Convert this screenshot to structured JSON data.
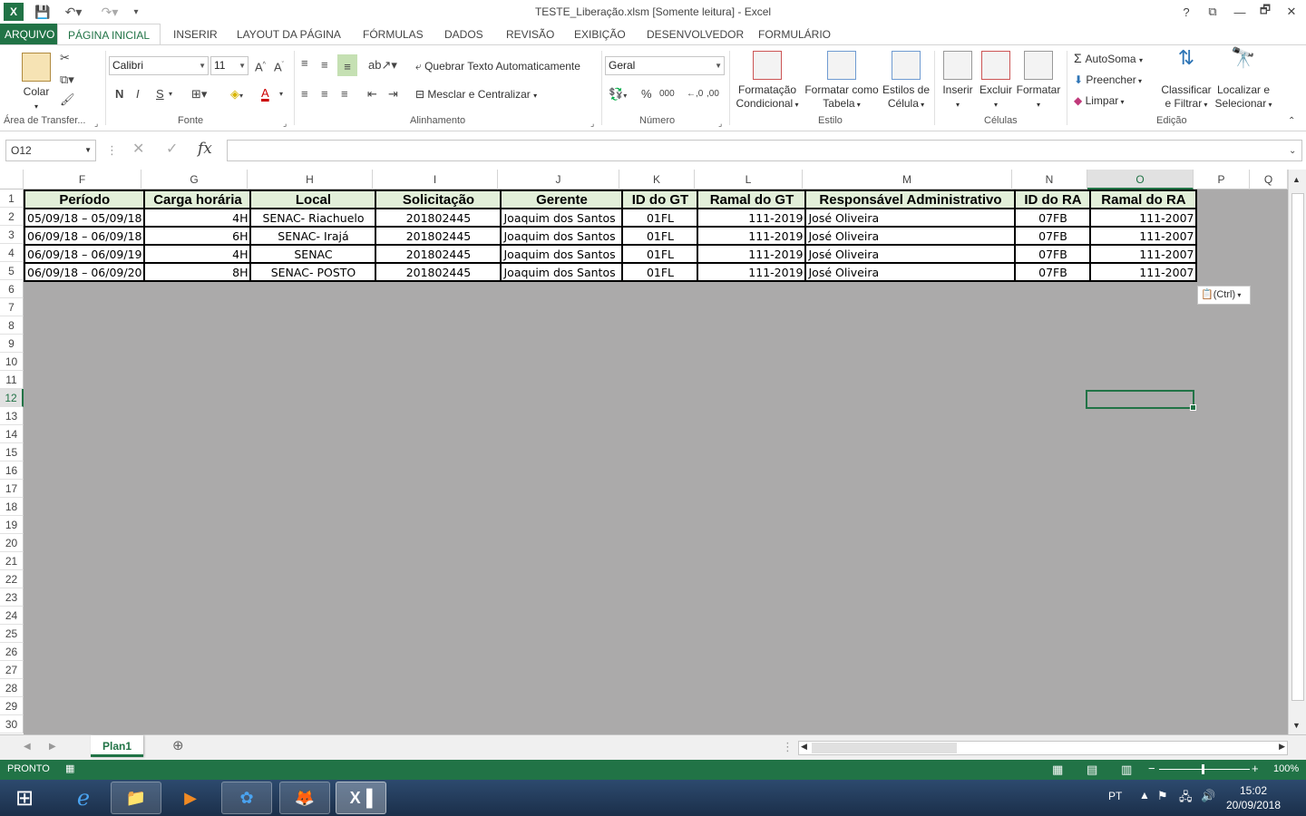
{
  "window": {
    "title": "TESTE_Liberação.xlsm  [Somente leitura] - Excel",
    "help": "?",
    "controls": [
      "⧉",
      "—",
      "🗗",
      "✕"
    ]
  },
  "ribbon_tabs": [
    "ARQUIVO",
    "PÁGINA INICIAL",
    "INSERIR",
    "LAYOUT DA PÁGINA",
    "FÓRMULAS",
    "DADOS",
    "REVISÃO",
    "EXIBIÇÃO",
    "DESENVOLVEDOR",
    "FORMULÁRIO"
  ],
  "ribbon": {
    "clipboard": {
      "paste": "Colar",
      "group": "Área de Transfer..."
    },
    "font": {
      "name": "Calibri",
      "size": "11",
      "bold": "N",
      "italic": "I",
      "underline": "S",
      "group": "Fonte"
    },
    "alignment": {
      "wrap": "Quebrar Texto Automaticamente",
      "merge": "Mesclar e Centralizar",
      "group": "Alinhamento"
    },
    "number": {
      "format": "Geral",
      "percent": "%",
      "thousands": "000",
      "group": "Número"
    },
    "styles": {
      "cond_1": "Formatação",
      "cond_2": "Condicional",
      "table_1": "Formatar como",
      "table_2": "Tabela",
      "cell_1": "Estilos de",
      "cell_2": "Célula",
      "group": "Estilo"
    },
    "cells": {
      "insert": "Inserir",
      "delete": "Excluir",
      "format": "Formatar",
      "group": "Células"
    },
    "editing": {
      "autosum": "AutoSoma",
      "fill": "Preencher",
      "clear": "Limpar",
      "sort_1": "Classificar",
      "sort_2": "e Filtrar",
      "find_1": "Localizar e",
      "find_2": "Selecionar",
      "group": "Edição"
    }
  },
  "formula_bar": {
    "name_box": "O12",
    "fx": "fx",
    "value": ""
  },
  "columns": [
    "F",
    "G",
    "H",
    "I",
    "J",
    "K",
    "L",
    "M",
    "N",
    "O",
    "P",
    "Q"
  ],
  "rows": [
    "1",
    "2",
    "3",
    "4",
    "5",
    "6",
    "7",
    "8",
    "9",
    "10",
    "11",
    "12",
    "13",
    "14",
    "15",
    "16",
    "17",
    "18",
    "19",
    "20",
    "21",
    "22",
    "23",
    "24",
    "25",
    "26",
    "27",
    "28",
    "29",
    "30"
  ],
  "table": {
    "headers": [
      "Período",
      "Carga horária",
      "Local",
      "Solicitação",
      "Gerente",
      "ID do GT",
      "Ramal do GT",
      "Responsável Administrativo",
      "ID do RA",
      "Ramal do RA"
    ],
    "rows": [
      [
        "05/09/18 – 05/09/18",
        "4H",
        "SENAC- Riachuelo",
        "201802445",
        "Joaquim dos Santos",
        "01FL",
        "111-2019",
        "José Oliveira",
        "07FB",
        "111-2007"
      ],
      [
        "06/09/18 – 06/09/18",
        "6H",
        "SENAC- Irajá",
        "201802445",
        "Joaquim dos Santos",
        "01FL",
        "111-2019",
        "José Oliveira",
        "07FB",
        "111-2007"
      ],
      [
        "06/09/18 – 06/09/19",
        "4H",
        "SENAC",
        "201802445",
        "Joaquim dos Santos",
        "01FL",
        "111-2019",
        "José Oliveira",
        "07FB",
        "111-2007"
      ],
      [
        "06/09/18 – 06/09/20",
        "8H",
        "SENAC- POSTO",
        "201802445",
        "Joaquim dos Santos",
        "01FL",
        "111-2019",
        "José Oliveira",
        "07FB",
        "111-2007"
      ]
    ]
  },
  "paste_options": "(Ctrl)",
  "sheet": {
    "name": "Plan1"
  },
  "status": {
    "ready": "PRONTO",
    "zoom": "100%"
  },
  "taskbar": {
    "lang": "PT",
    "time": "15:02",
    "date": "20/09/2018"
  }
}
